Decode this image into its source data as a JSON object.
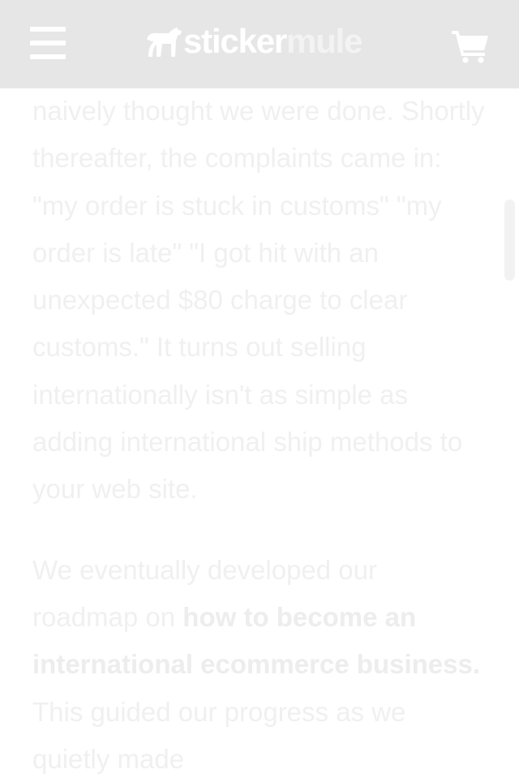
{
  "header": {
    "menu_icon": "hamburger-menu-icon",
    "logo": {
      "part1": "sticker",
      "part2": "mule",
      "mark_icon": "mule-logo-icon"
    },
    "cart_icon": "shopping-cart-icon",
    "background": "#e6e6e6"
  },
  "article": {
    "paragraph1": "naively thought we were done. Shortly thereafter, the complaints came in: \"my order is stuck in customs\" \"my order is late\" \"I got hit with an unexpected $80 charge to clear customs.\" It turns out selling internationally isn't as simple as adding international ship methods to your web site.",
    "paragraph2_before": "We eventually developed our roadmap on ",
    "paragraph2_link": "how to become an international ecommerce business.",
    "paragraph2_after": " This guided our progress as we quietly made",
    "text_color": "#f0f0f0"
  }
}
